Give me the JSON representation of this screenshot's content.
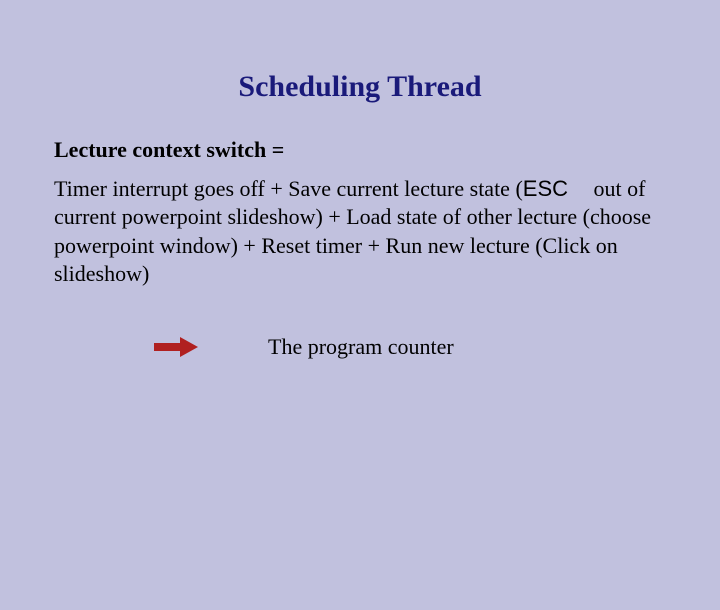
{
  "slide": {
    "title": "Scheduling Thread",
    "heading": "Lecture context switch =",
    "paragraph_prefix": "Timer interrupt goes off + Save current lecture state (",
    "key_label": "ESC",
    "paragraph_suffix": " out of current powerpoint slideshow) + Load state of other lecture (choose powerpoint window) + Reset timer + Run new lecture (Click on slideshow)",
    "arrow_label": "The program counter"
  }
}
